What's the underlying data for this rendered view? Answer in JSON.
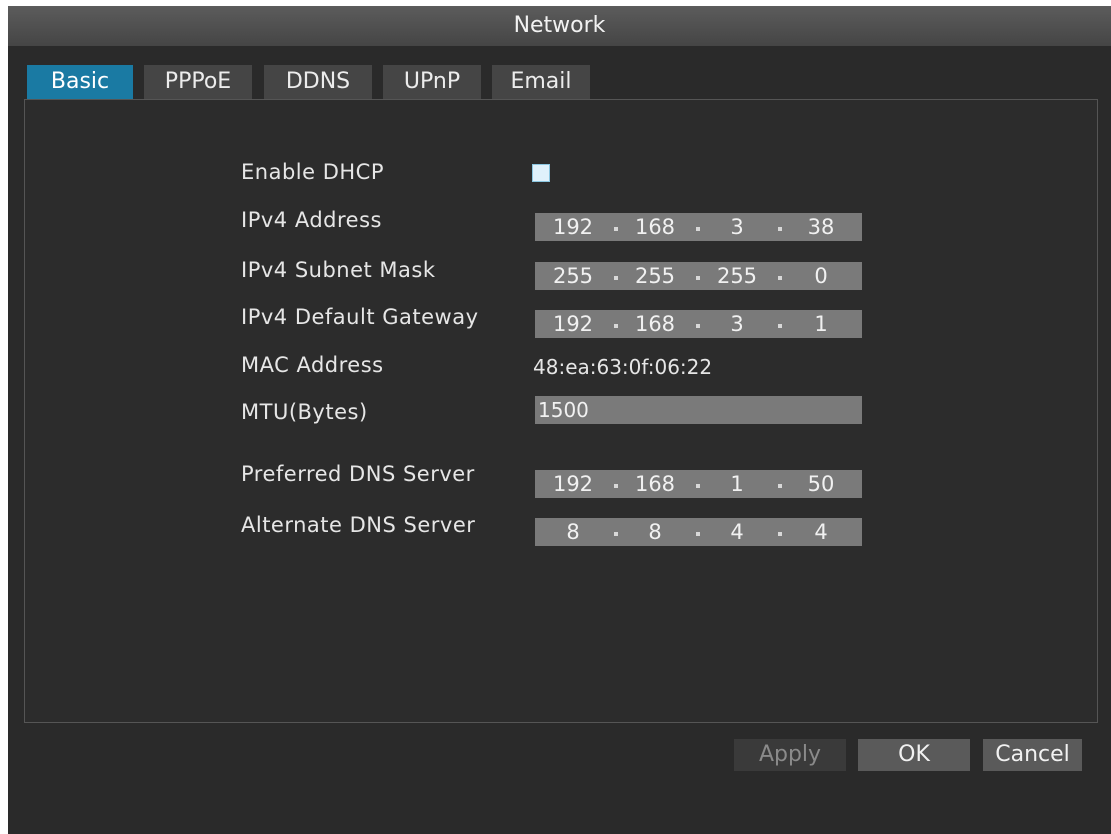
{
  "window": {
    "title": "Network"
  },
  "tabs": [
    {
      "label": "Basic",
      "active": true
    },
    {
      "label": "PPPoE",
      "active": false
    },
    {
      "label": "DDNS",
      "active": false
    },
    {
      "label": "UPnP",
      "active": false
    },
    {
      "label": "Email",
      "active": false
    }
  ],
  "form": {
    "dhcp": {
      "label": "Enable DHCP",
      "checked": false
    },
    "ipv4_address": {
      "label": "IPv4 Address",
      "octets": [
        "192",
        "168",
        "3",
        "38"
      ]
    },
    "subnet_mask": {
      "label": "IPv4 Subnet Mask",
      "octets": [
        "255",
        "255",
        "255",
        "0"
      ]
    },
    "gateway": {
      "label": "IPv4 Default Gateway",
      "octets": [
        "192",
        "168",
        "3",
        "1"
      ]
    },
    "mac": {
      "label": "MAC Address",
      "value": "48:ea:63:0f:06:22"
    },
    "mtu": {
      "label": "MTU(Bytes)",
      "value": "1500"
    },
    "preferred_dns": {
      "label": "Preferred DNS Server",
      "octets": [
        "192",
        "168",
        "1",
        "50"
      ]
    },
    "alternate_dns": {
      "label": "Alternate DNS Server",
      "octets": [
        "8",
        "8",
        "4",
        "4"
      ]
    }
  },
  "buttons": {
    "apply": "Apply",
    "ok": "OK",
    "cancel": "Cancel"
  },
  "colors": {
    "accent": "#1a7aa3",
    "background": "#2a2a2a",
    "field": "#7a7a7a"
  }
}
